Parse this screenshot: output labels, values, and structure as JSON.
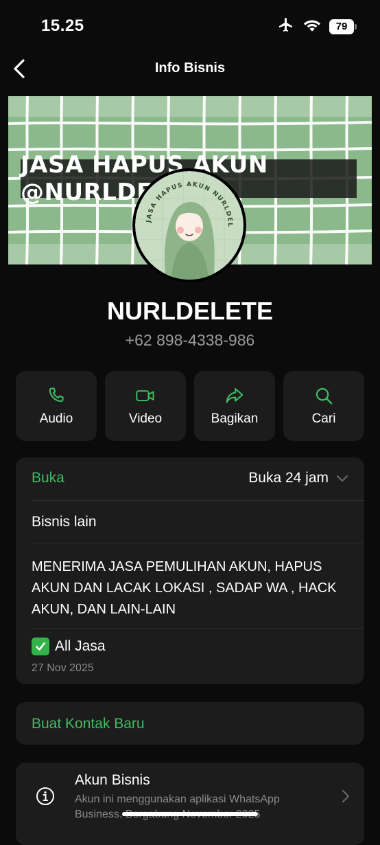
{
  "status_bar": {
    "time": "15.25",
    "battery_level": "79",
    "icons": [
      "airplane-icon",
      "wifi-icon",
      "battery-icon"
    ]
  },
  "nav": {
    "title": "Info Bisnis",
    "back_icon": "chevron-left-icon"
  },
  "cover": {
    "text": "JASA HAPUS AKUN @NURLDELETE",
    "avatar_arc_text": "JASA HAPUS AKUN NURLDELETE"
  },
  "profile": {
    "name": "NURLDELETE",
    "phone": "+62 898-4338-986"
  },
  "actions": [
    {
      "label": "Audio",
      "icon": "phone-icon"
    },
    {
      "label": "Video",
      "icon": "video-icon"
    },
    {
      "label": "Bagikan",
      "icon": "share-icon"
    },
    {
      "label": "Cari",
      "icon": "search-icon"
    }
  ],
  "info": {
    "hours_label": "Buka",
    "hours_value": "Buka 24 jam",
    "category": "Bisnis lain",
    "description": "MENERIMA JASA PEMULIHAN AKUN, HAPUS AKUN DAN LACAK LOKASI , SADAP WA , HACK AKUN, DAN LAIN-LAIN",
    "catalog_title": "All Jasa",
    "catalog_date": "27 Nov 2025"
  },
  "contact": {
    "create_label": "Buat Kontak Baru"
  },
  "business_account": {
    "title": "Akun Bisnis",
    "subtitle": "Akun ini menggunakan aplikasi WhatsApp Business. Bergabung November 2025"
  },
  "colors": {
    "accent": "#3fbd63",
    "background": "#0b0b0b",
    "card": "#1c1c1c",
    "secondary_text": "#8a8a8a"
  }
}
